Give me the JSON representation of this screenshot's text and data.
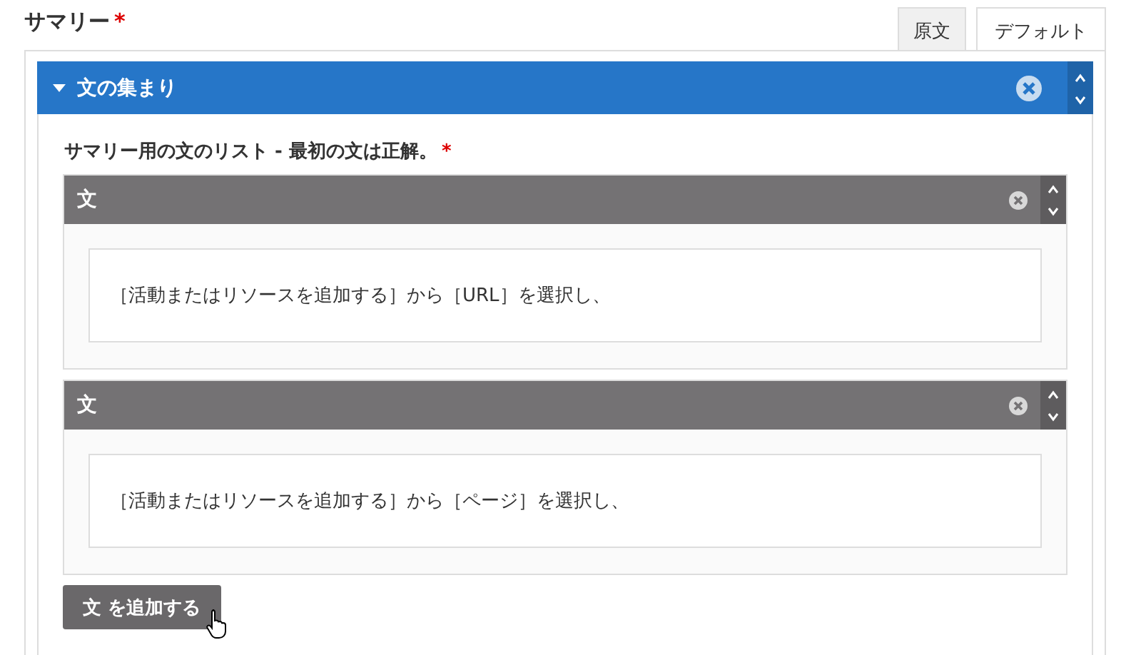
{
  "field": {
    "label": "サマリー",
    "required_mark": "*"
  },
  "tabs": [
    {
      "label": "原文",
      "selected": false
    },
    {
      "label": "デフォルト",
      "selected": true
    }
  ],
  "group": {
    "title": "文の集まり",
    "expanded": true,
    "list_label": "サマリー用の文のリスト - 最初の文は正解。",
    "required_mark": "*",
    "sentences": [
      {
        "title": "文",
        "value": "［活動またはリソースを追加する］から［URL］を選択し、"
      },
      {
        "title": "文",
        "value": "［活動またはリソースを追加する］から［ページ］を選択し、"
      }
    ],
    "add_button": "文 を追加する"
  }
}
